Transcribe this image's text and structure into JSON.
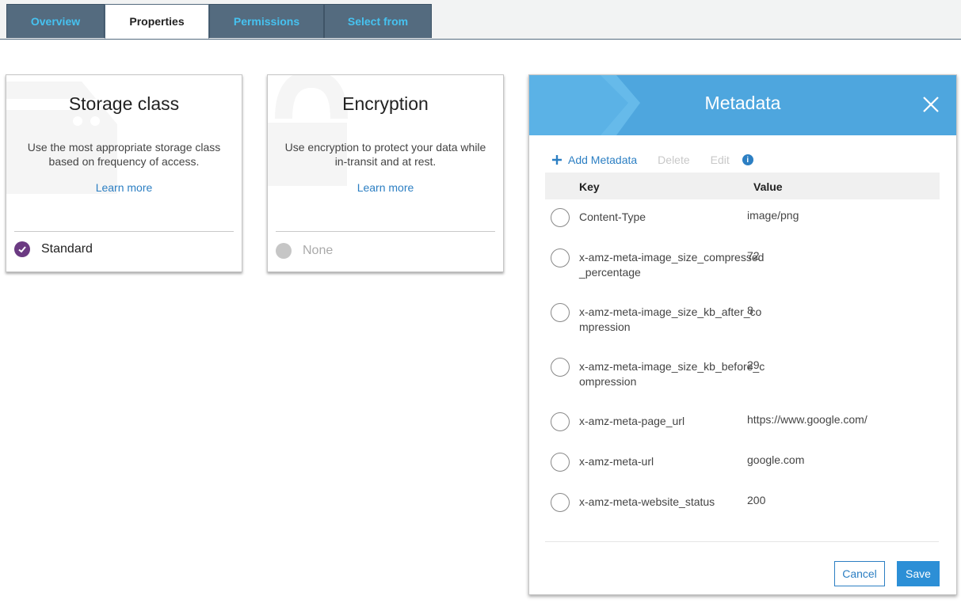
{
  "tabs": [
    {
      "label": "Overview",
      "active": false
    },
    {
      "label": "Properties",
      "active": true
    },
    {
      "label": "Permissions",
      "active": false
    },
    {
      "label": "Select from",
      "active": false
    }
  ],
  "storage_card": {
    "title": "Storage class",
    "description": "Use the most appropriate storage class based on frequency of access.",
    "learn_more": "Learn more",
    "selected_value": "Standard",
    "icon": "storage-watermark-icon"
  },
  "encryption_card": {
    "title": "Encryption",
    "description": "Use encryption to protect your data while in-transit and at rest.",
    "learn_more": "Learn more",
    "selected_value": "None",
    "icon": "lock-watermark-icon"
  },
  "metadata_panel": {
    "title": "Metadata",
    "toolbar": {
      "add_label": "Add Metadata",
      "delete_label": "Delete",
      "edit_label": "Edit",
      "info_glyph": "i"
    },
    "columns": {
      "key": "Key",
      "value": "Value"
    },
    "rows": [
      {
        "key": "Content-Type",
        "value": "image/png"
      },
      {
        "key": "x-amz-meta-image_size_compressed_percentage",
        "value": "72"
      },
      {
        "key": "x-amz-meta-image_size_kb_after_compression",
        "value": "8"
      },
      {
        "key": "x-amz-meta-image_size_kb_before_compression",
        "value": "29"
      },
      {
        "key": "x-amz-meta-page_url",
        "value": "https://www.google.com/"
      },
      {
        "key": "x-amz-meta-url",
        "value": "google.com"
      },
      {
        "key": "x-amz-meta-website_status",
        "value": "200"
      }
    ],
    "cancel_label": "Cancel",
    "save_label": "Save"
  },
  "colors": {
    "tab_bg": "#546b7f",
    "tab_text": "#46c2f0",
    "accent": "#2c7fc3",
    "header_blue": "#4ea6de",
    "selected_purple": "#6b3a82"
  }
}
